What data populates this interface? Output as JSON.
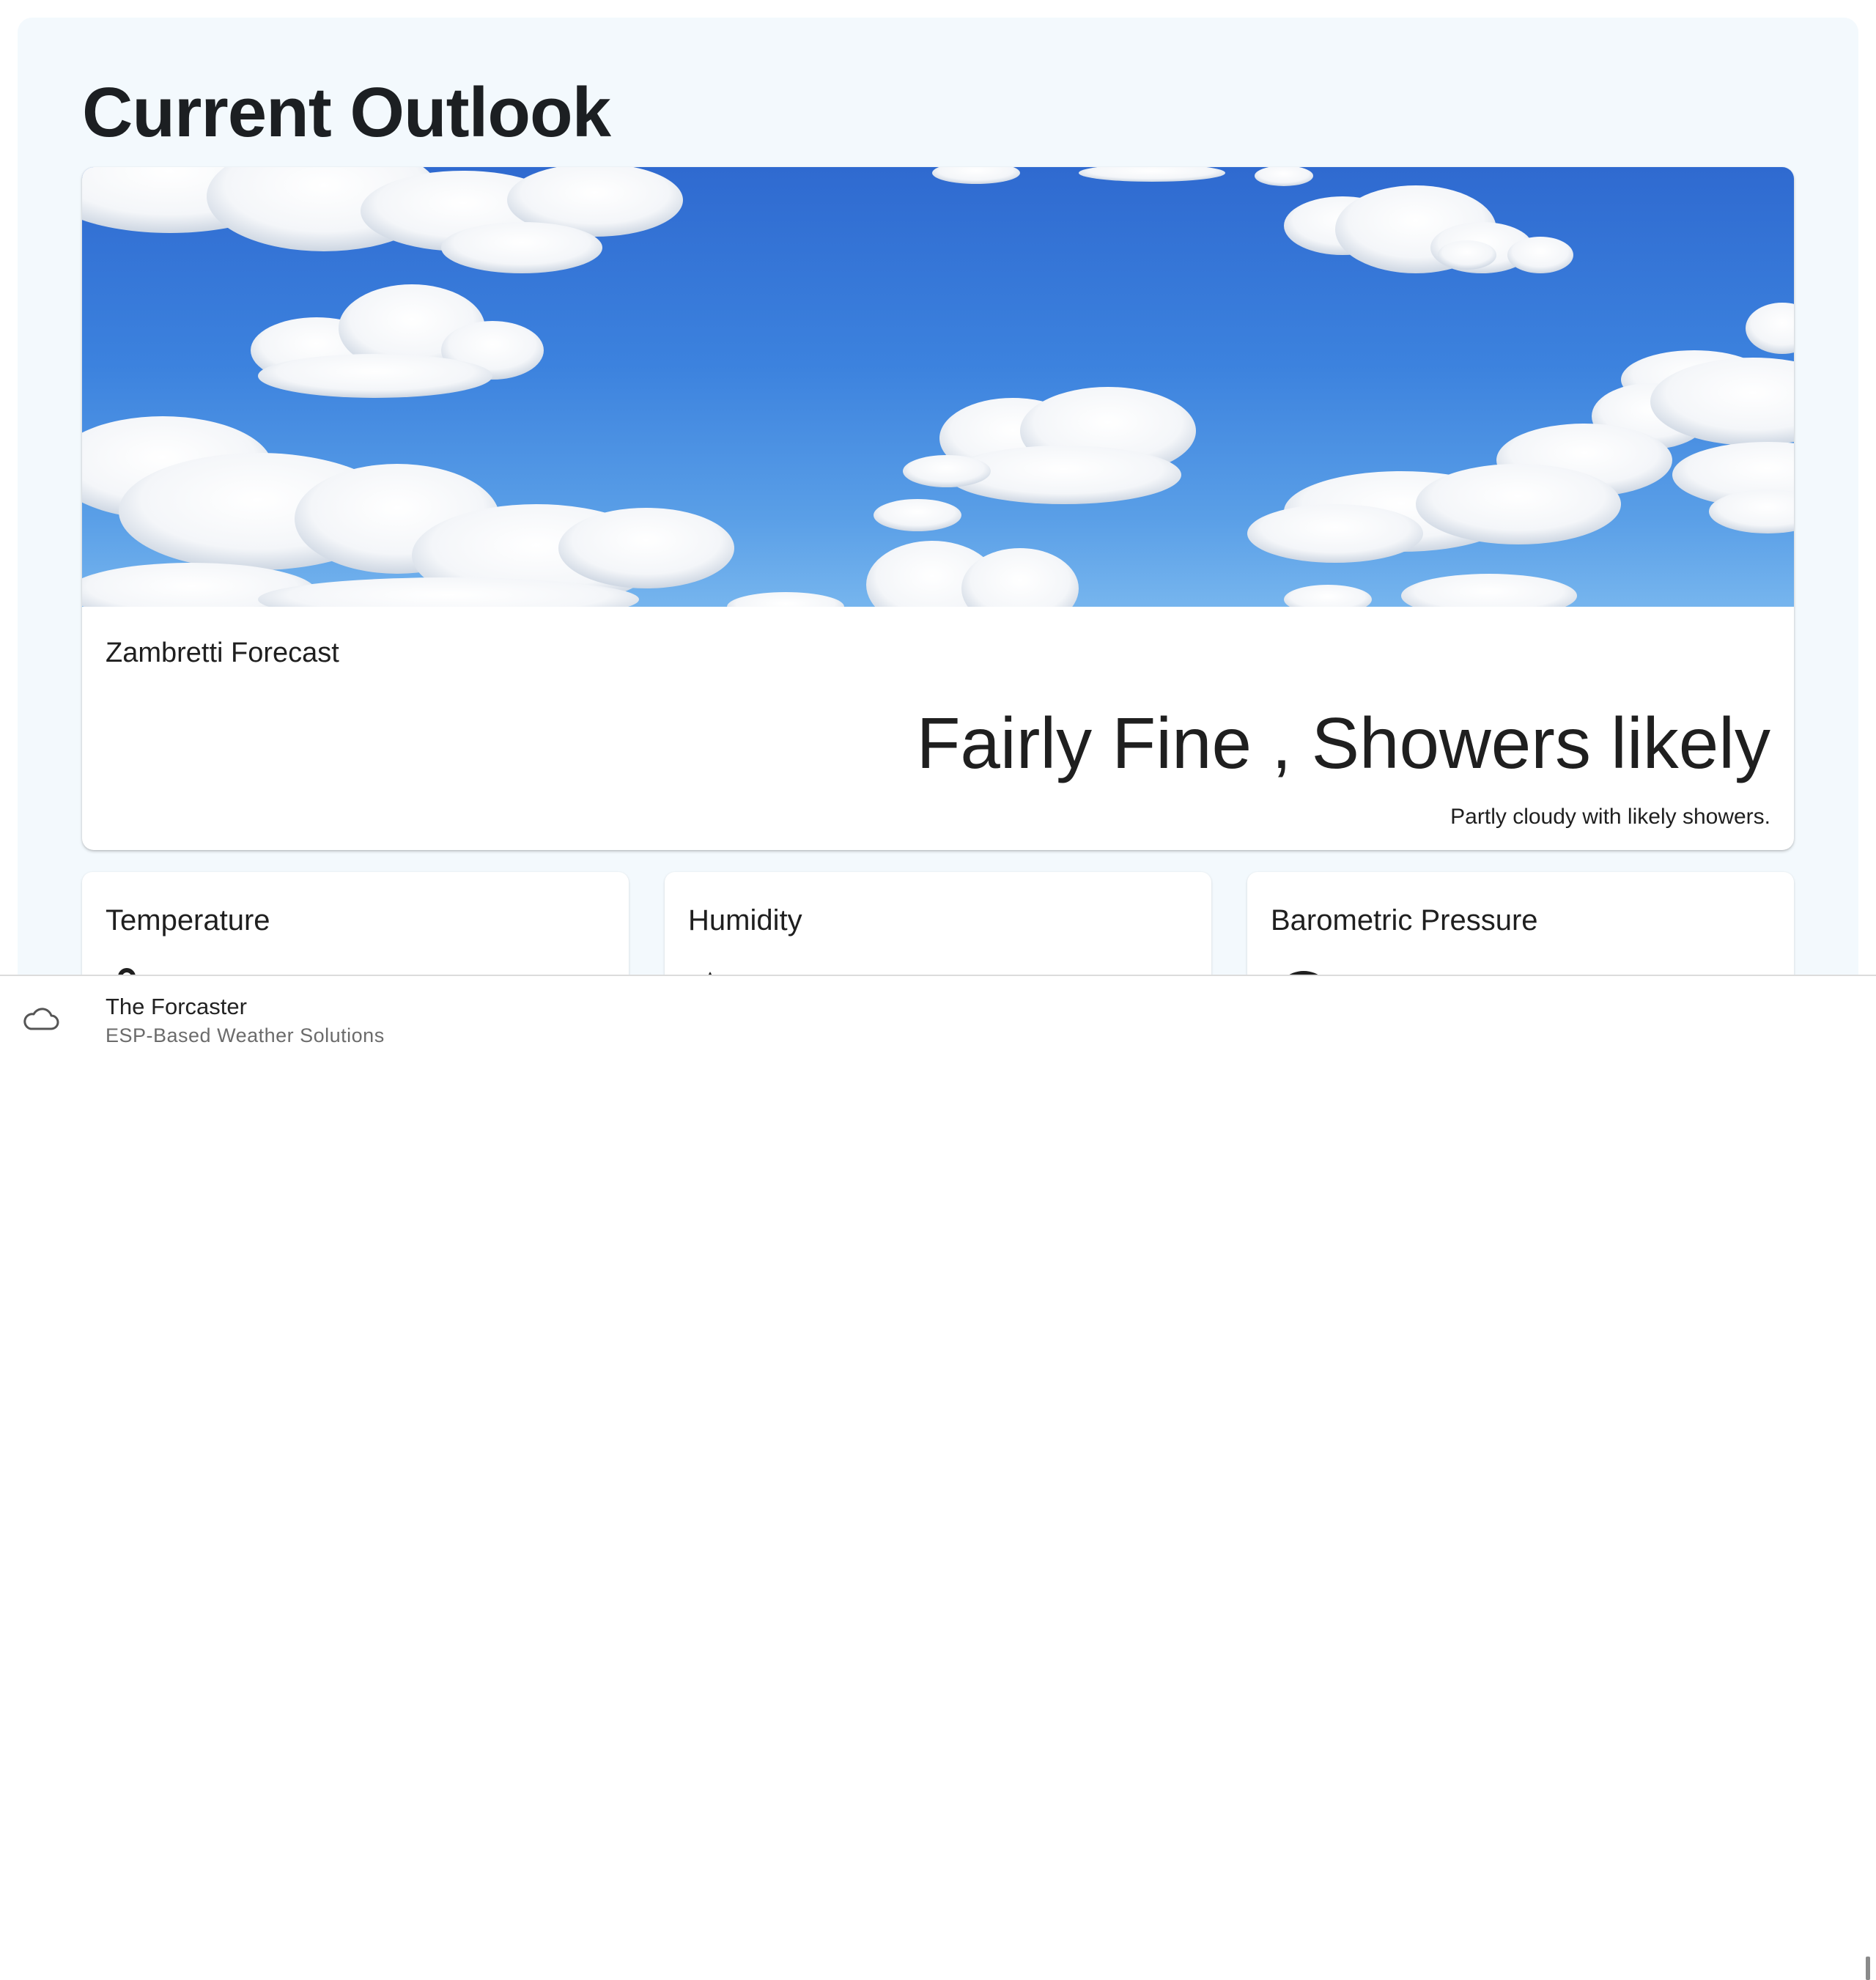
{
  "page": {
    "title": "Current Outlook"
  },
  "outlook": {
    "label": "Zambretti Forecast",
    "forecast": "Fairly Fine , Showers likely",
    "description": "Partly cloudy with likely showers.",
    "image_icon": "sky-with-clouds-image"
  },
  "metrics": [
    {
      "title": "Temperature",
      "icon": "thermometer-icon"
    },
    {
      "title": "Humidity",
      "icon": "water-drop-icon"
    },
    {
      "title": "Barometric Pressure",
      "icon": "gauge-icon"
    }
  ],
  "footer": {
    "icon": "cloud-icon",
    "title": "The Forcaster",
    "subtitle": "ESP-Based Weather Solutions"
  },
  "colors": {
    "page_background": "#f3f9fd",
    "sky_top": "#2f6ad0",
    "sky_bottom": "#76b5ee",
    "text": "#1f1f1f"
  }
}
